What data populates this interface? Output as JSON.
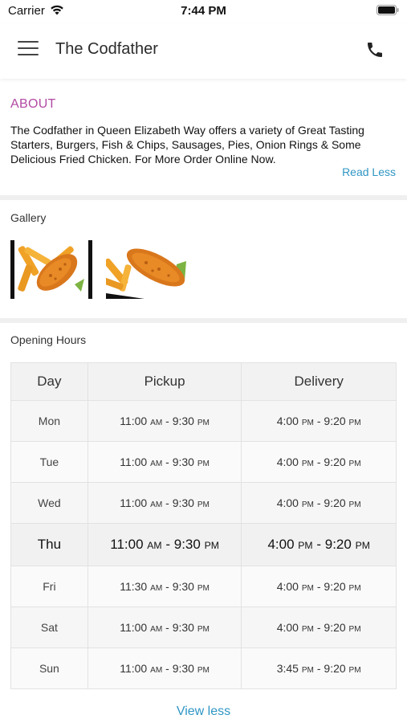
{
  "status_bar": {
    "carrier": "Carrier",
    "time": "7:44 PM"
  },
  "nav": {
    "title": "The Codfather"
  },
  "about": {
    "heading": "ABOUT",
    "text": "The Codfather in Queen Elizabeth Way offers a variety of Great Tasting Starters, Burgers, Fish & Chips, Sausages, Pies, Onion Rings & Some Delicious Fried Chicken. For More Order Online Now.",
    "toggle": "Read Less"
  },
  "gallery": {
    "heading": "Gallery",
    "images": [
      "fish-and-chips",
      "fish-and-chips"
    ]
  },
  "opening_hours": {
    "heading": "Opening Hours",
    "columns": [
      "Day",
      "Pickup",
      "Delivery"
    ],
    "rows": [
      {
        "day": "Mon",
        "pickup": [
          "11:00",
          "AM",
          "9:30",
          "PM"
        ],
        "delivery": [
          "4:00",
          "PM",
          "9:20",
          "PM"
        ]
      },
      {
        "day": "Tue",
        "pickup": [
          "11:00",
          "AM",
          "9:30",
          "PM"
        ],
        "delivery": [
          "4:00",
          "PM",
          "9:20",
          "PM"
        ]
      },
      {
        "day": "Wed",
        "pickup": [
          "11:00",
          "AM",
          "9:30",
          "PM"
        ],
        "delivery": [
          "4:00",
          "PM",
          "9:20",
          "PM"
        ]
      },
      {
        "day": "Thu",
        "pickup": [
          "11:00",
          "AM",
          "9:30",
          "PM"
        ],
        "delivery": [
          "4:00",
          "PM",
          "9:20",
          "PM"
        ],
        "today": true
      },
      {
        "day": "Fri",
        "pickup": [
          "11:30",
          "AM",
          "9:30",
          "PM"
        ],
        "delivery": [
          "4:00",
          "PM",
          "9:20",
          "PM"
        ]
      },
      {
        "day": "Sat",
        "pickup": [
          "11:00",
          "AM",
          "9:30",
          "PM"
        ],
        "delivery": [
          "4:00",
          "PM",
          "9:20",
          "PM"
        ]
      },
      {
        "day": "Sun",
        "pickup": [
          "11:00",
          "AM",
          "9:30",
          "PM"
        ],
        "delivery": [
          "3:45",
          "PM",
          "9:20",
          "PM"
        ]
      }
    ],
    "toggle": "View less"
  },
  "colors": {
    "accent_heading": "#b24aa3",
    "link": "#2f96c4"
  }
}
